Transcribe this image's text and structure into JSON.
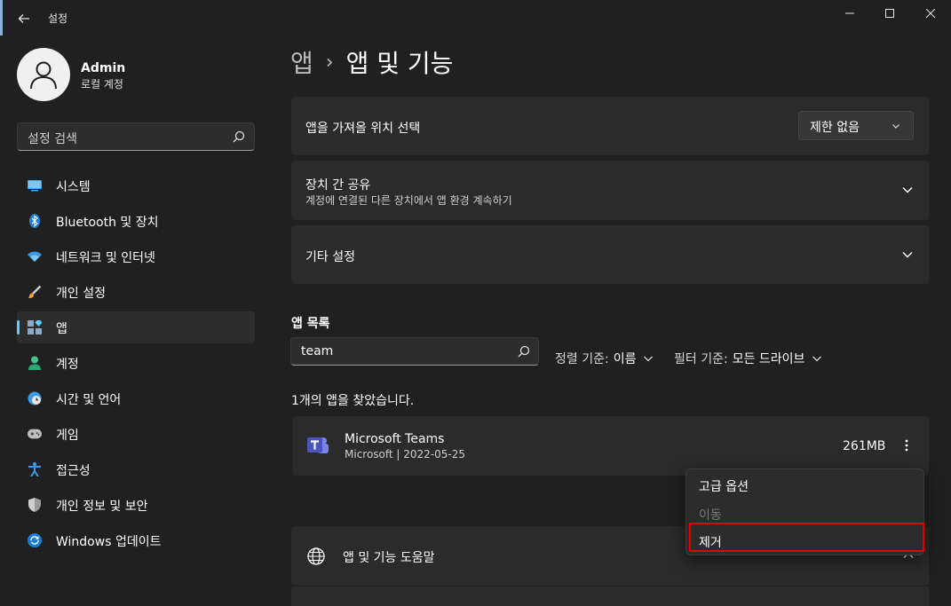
{
  "window": {
    "title": "설정"
  },
  "profile": {
    "name": "Admin",
    "account_type": "로컬 계정"
  },
  "sidebar": {
    "search_placeholder": "설정 검색",
    "items": [
      {
        "label": "시스템",
        "icon": "monitor-icon"
      },
      {
        "label": "Bluetooth 및 장치",
        "icon": "bluetooth-icon"
      },
      {
        "label": "네트워크 및 인터넷",
        "icon": "wifi-icon"
      },
      {
        "label": "개인 설정",
        "icon": "brush-icon"
      },
      {
        "label": "앱",
        "icon": "apps-icon",
        "selected": true
      },
      {
        "label": "계정",
        "icon": "person-icon"
      },
      {
        "label": "시간 및 언어",
        "icon": "globe-clock-icon"
      },
      {
        "label": "게임",
        "icon": "gamepad-icon"
      },
      {
        "label": "접근성",
        "icon": "accessibility-icon"
      },
      {
        "label": "개인 정보 및 보안",
        "icon": "shield-icon"
      },
      {
        "label": "Windows 업데이트",
        "icon": "update-icon"
      }
    ]
  },
  "breadcrumb": {
    "parent": "앱",
    "separator": "›",
    "current": "앱 및 기능"
  },
  "settings": {
    "install_source": {
      "label": "앱을 가져올 위치 선택",
      "value": "제한 없음"
    },
    "share_devices": {
      "title": "장치 간 공유",
      "subtitle": "계정에 연결된 다른 장치에서 앱 환경 계속하기"
    },
    "more_settings": {
      "title": "기타 설정"
    }
  },
  "app_list": {
    "section_title": "앱 목록",
    "search_value": "team",
    "sort_label": "정렬 기준:",
    "sort_value": "이름",
    "filter_label": "필터 기준:",
    "filter_value": "모든 드라이브",
    "result_text": "1개의 앱을 찾았습니다.",
    "apps": [
      {
        "name": "Microsoft Teams",
        "meta": "Microsoft   |   2022-05-25",
        "size": "261MB",
        "icon": "teams-icon"
      }
    ]
  },
  "context_menu": {
    "items": [
      {
        "label": "고급 옵션",
        "enabled": true
      },
      {
        "label": "이동",
        "enabled": false
      },
      {
        "label": "제거",
        "enabled": true,
        "highlighted": true
      }
    ]
  },
  "help": {
    "label": "앱 및 기능 도움말"
  },
  "colors": {
    "background": "#202020",
    "card": "#2b2b2b",
    "accent": "#60cdff",
    "highlight_box": "#e00000"
  }
}
